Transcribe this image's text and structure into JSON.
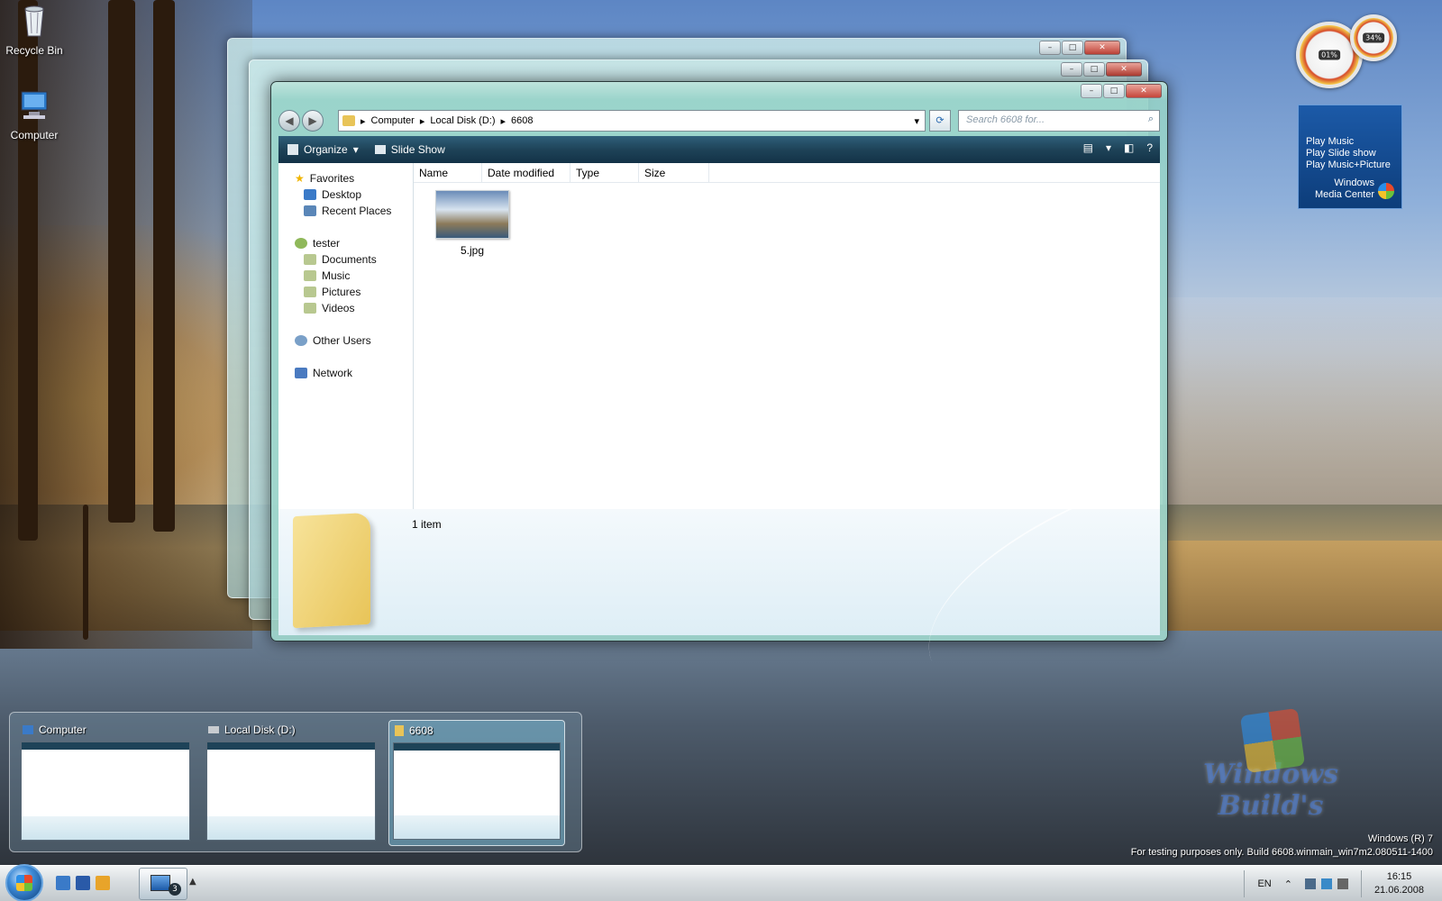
{
  "desktop": {
    "icons": [
      {
        "label": "Recycle Bin",
        "icon": "recycle-bin-icon"
      },
      {
        "label": "Computer",
        "icon": "computer-icon"
      }
    ]
  },
  "gadgets": {
    "cpu_percent": "01%",
    "mem_percent": "34%",
    "media_center": {
      "items": [
        "Play Music",
        "Play Slide show",
        "Play Music+Picture"
      ],
      "brand_line1": "Windows",
      "brand_line2": "Media Center"
    }
  },
  "window": {
    "breadcrumb": [
      "Computer",
      "Local Disk (D:)",
      "6608"
    ],
    "search_placeholder": "Search 6608 for...",
    "toolbar": {
      "organize": "Organize",
      "slideshow": "Slide Show"
    },
    "nav": {
      "favorites": "Favorites",
      "favorites_items": [
        "Desktop",
        "Recent Places"
      ],
      "user": "tester",
      "user_items": [
        "Documents",
        "Music",
        "Pictures",
        "Videos"
      ],
      "other_users": "Other Users",
      "network": "Network"
    },
    "columns": [
      "Name",
      "Date modified",
      "Type",
      "Size"
    ],
    "files": [
      {
        "name": "5.jpg"
      }
    ],
    "details_count": "1 item"
  },
  "previews": [
    {
      "title": "Computer",
      "active": false
    },
    {
      "title": "Local Disk (D:)",
      "active": false
    },
    {
      "title": "6608",
      "active": true
    }
  ],
  "watermark": {
    "logo_text": "Windows Build's",
    "line1": "Windows (R) 7",
    "line2": "For testing purposes only. Build 6608.winmain_win7m2.080511-1400"
  },
  "taskbar": {
    "task_count": "3",
    "language": "EN",
    "time": "16:15",
    "date": "21.06.2008"
  },
  "colors": {
    "toolbar": "#1e4358",
    "accent": "#2a8ee8"
  }
}
